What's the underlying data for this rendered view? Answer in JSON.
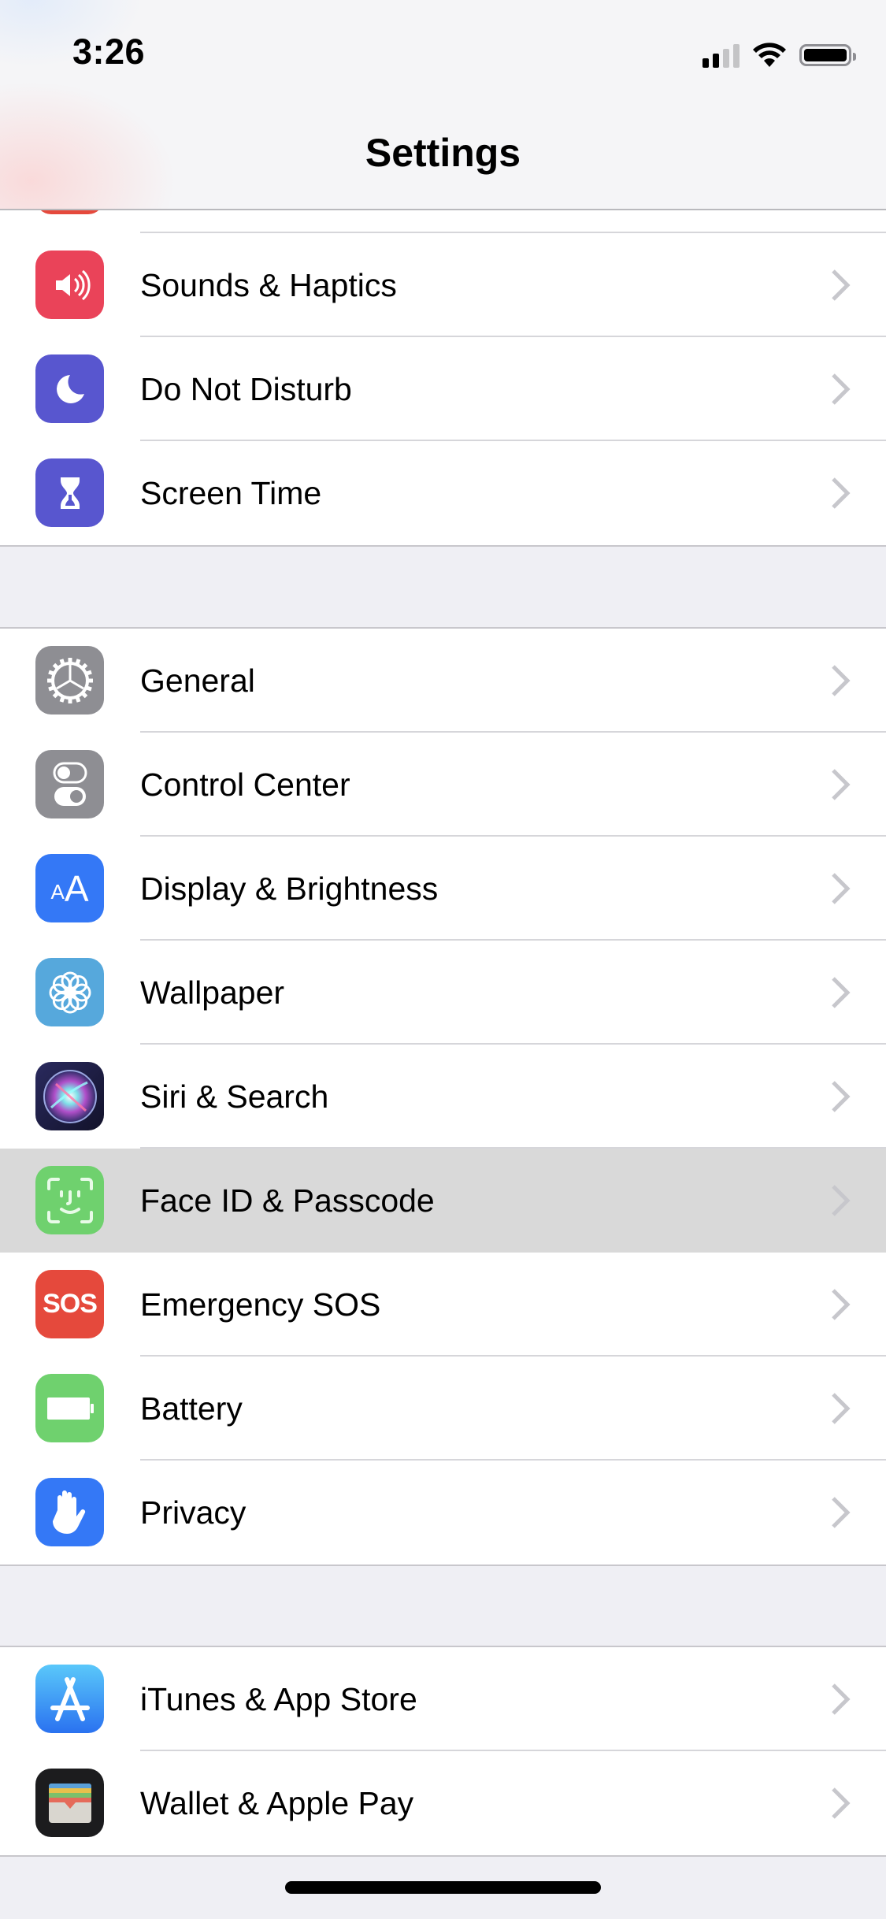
{
  "status_bar": {
    "time": "3:26",
    "signal_bars_active": 2,
    "signal_bars_total": 4,
    "wifi": "wifi-icon",
    "battery": "battery-full-icon"
  },
  "header": {
    "title": "Settings"
  },
  "colors": {
    "grouped_background": "#efeff4",
    "separator": "#c8c7cc",
    "chevron": "#c7c7cc",
    "highlight_row": "#d9d9d9"
  },
  "groups": [
    {
      "items": [
        {
          "label": "Sounds & Haptics",
          "icon": "speaker-icon",
          "icon_color": "#ea4359"
        },
        {
          "label": "Do Not Disturb",
          "icon": "moon-icon",
          "icon_color": "#5856cf"
        },
        {
          "label": "Screen Time",
          "icon": "hourglass-icon",
          "icon_color": "#5856cf"
        }
      ]
    },
    {
      "items": [
        {
          "label": "General",
          "icon": "gear-icon",
          "icon_color": "#8e8e93"
        },
        {
          "label": "Control Center",
          "icon": "toggles-icon",
          "icon_color": "#8e8e93"
        },
        {
          "label": "Display & Brightness",
          "icon": "text-size-icon",
          "icon_color": "#3478f6",
          "icon_text": "AA"
        },
        {
          "label": "Wallpaper",
          "icon": "flower-icon",
          "icon_color": "#56a8dc"
        },
        {
          "label": "Siri & Search",
          "icon": "siri-icon",
          "icon_color": "#1c1c3c"
        },
        {
          "label": "Face ID & Passcode",
          "icon": "face-id-icon",
          "icon_color": "#6fd16e",
          "selected": true
        },
        {
          "label": "Emergency SOS",
          "icon": "sos-icon",
          "icon_color": "#e5493c",
          "icon_text": "SOS"
        },
        {
          "label": "Battery",
          "icon": "battery-icon",
          "icon_color": "#6fd16e"
        },
        {
          "label": "Privacy",
          "icon": "hand-icon",
          "icon_color": "#3478f6"
        }
      ]
    },
    {
      "items": [
        {
          "label": "iTunes & App Store",
          "icon": "app-store-icon",
          "icon_color": "#2f8cf5"
        },
        {
          "label": "Wallet & Apple Pay",
          "icon": "wallet-icon",
          "icon_color": "#1c1c1e"
        }
      ]
    }
  ]
}
